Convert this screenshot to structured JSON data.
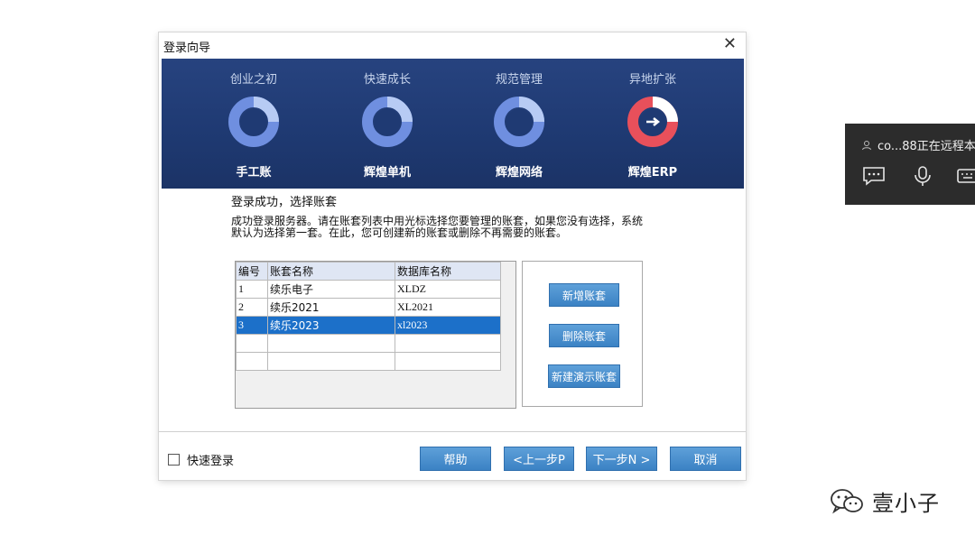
{
  "dialog": {
    "title": "登录向导",
    "close_glyph": "✕"
  },
  "banner": {
    "stages": [
      {
        "top": "创业之初",
        "bottom": "手工账",
        "active": false
      },
      {
        "top": "快速成长",
        "bottom": "辉煌单机",
        "active": false
      },
      {
        "top": "规范管理",
        "bottom": "辉煌网络",
        "active": false
      },
      {
        "top": "异地扩张",
        "bottom": "辉煌ERP",
        "active": true
      }
    ],
    "colors": {
      "ring_blue": "#6f8fe0",
      "ring_light": "#b7cbf4",
      "ring_red": "#e8505b",
      "background": "#1f3a73"
    }
  },
  "content": {
    "heading": "登录成功，选择账套",
    "intro": "成功登录服务器。请在账套列表中用光标选择您要管理的账套，如果您没有选择，系统默认为选择第一套。在此，您可创建新的账套或删除不再需要的账套。"
  },
  "table": {
    "columns": [
      "编号",
      "账套名称",
      "数据库名称"
    ],
    "rows": [
      {
        "id": "1",
        "name": "续乐电子",
        "db": "XLDZ"
      },
      {
        "id": "2",
        "name": "续乐2021",
        "db": "XL2021"
      },
      {
        "id": "3",
        "name": "续乐2023",
        "db": "xl2023"
      }
    ],
    "selected_row": 3
  },
  "side_buttons": {
    "add": "新增账套",
    "delete": "删除账套",
    "demo": "新建演示账套"
  },
  "footer": {
    "quick_login": "快速登录",
    "help": "帮助",
    "prev": "<上一步P",
    "next": "下一步N >",
    "cancel": "取消"
  },
  "remote_toolbar": {
    "user_text": "co...88正在远程本",
    "icons": [
      "chat-icon",
      "microphone-icon",
      "keyboard-icon"
    ]
  },
  "watermark": {
    "text": "壹小子"
  }
}
